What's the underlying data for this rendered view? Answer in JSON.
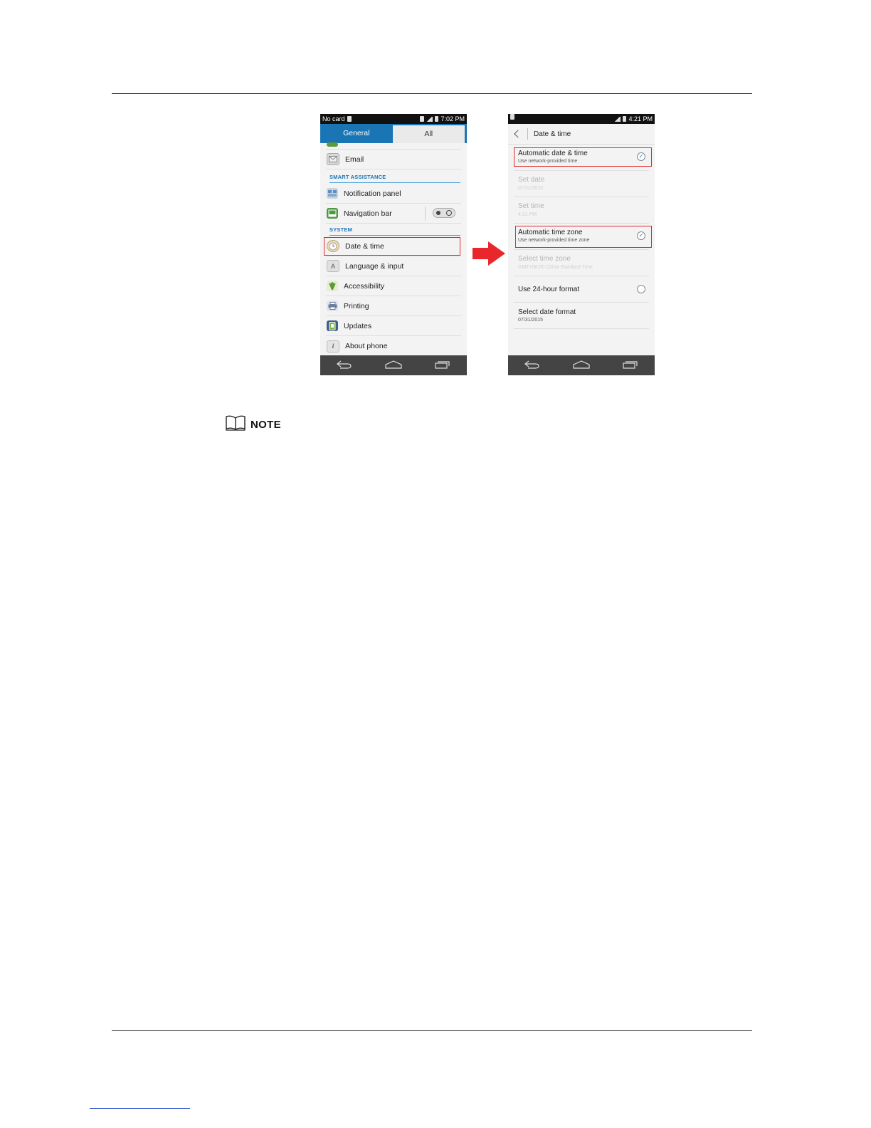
{
  "left_phone": {
    "status": {
      "carrier": "No card",
      "time": "7:02 PM"
    },
    "tabs": [
      {
        "label": "General"
      },
      {
        "label": "All"
      }
    ],
    "items": {
      "email": "Email",
      "smart_assistance": "SMART ASSISTANCE",
      "notification_panel": "Notification panel",
      "navigation_bar": "Navigation bar",
      "system": "SYSTEM",
      "date_time": "Date & time",
      "language_input": "Language & input",
      "accessibility": "Accessibility",
      "printing": "Printing",
      "updates": "Updates",
      "about_phone": "About phone"
    },
    "icons": {
      "language_glyph": "A",
      "about_glyph": "i"
    }
  },
  "right_phone": {
    "status": {
      "time": "4:21 PM"
    },
    "header": {
      "title": "Date & time"
    },
    "rows": {
      "auto_date_time": {
        "title": "Automatic date & time",
        "subtitle": "Use network-provided time"
      },
      "set_date": {
        "title": "Set date",
        "subtitle": "07/31/2015"
      },
      "set_time": {
        "title": "Set time",
        "subtitle": "4:21 PM"
      },
      "auto_time_zone": {
        "title": "Automatic time zone",
        "subtitle": "Use network-provided time zone"
      },
      "select_time_zone": {
        "title": "Select time zone",
        "subtitle": "GMT+08:00 China Standard Time"
      },
      "use_24h": {
        "title": "Use 24-hour format"
      },
      "date_format": {
        "title": "Select date format",
        "subtitle": "07/31/2015"
      }
    },
    "check_glyph": "✓"
  },
  "note": {
    "label": "NOTE"
  },
  "colors": {
    "accent": "#1a75b5",
    "highlight": "#e02a2a",
    "arrow": "#e8262b"
  }
}
